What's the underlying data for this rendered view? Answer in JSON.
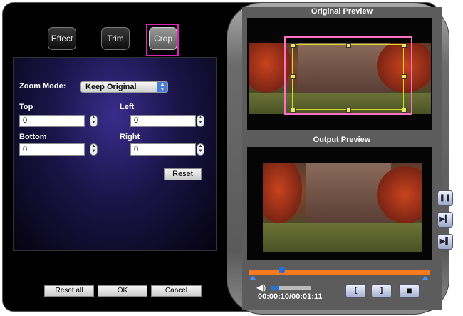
{
  "tabs": {
    "effect": "Effect",
    "trim": "Trim",
    "crop": "Crop"
  },
  "crop_panel": {
    "zoom_mode_label": "Zoom Mode:",
    "zoom_mode_value": "Keep Original",
    "top_label": "Top",
    "top_value": "0",
    "left_label": "Left",
    "left_value": "0",
    "bottom_label": "Bottom",
    "bottom_value": "0",
    "right_label": "Right",
    "right_value": "0",
    "reset_label": "Reset"
  },
  "footer": {
    "reset_all_label": "Reset all",
    "ok_label": "OK",
    "cancel_label": "Cancel"
  },
  "preview": {
    "original_title": "Original Preview",
    "output_title": "Output Preview",
    "time_readout": "00:00:10/00:01:11",
    "progress_fraction": 0.14,
    "volume_fraction": 0.2
  },
  "colors": {
    "highlight": "#e022b8",
    "timeline": "#ff7a1e",
    "crop_frame": "#ff6fc2"
  },
  "icons": {
    "pause": "pause-icon",
    "step": "step-forward-icon",
    "jump": "jump-end-icon",
    "volume": "speaker-icon",
    "mark_in": "bracket-open-icon",
    "mark_out": "bracket-close-icon",
    "stop": "stop-icon"
  }
}
